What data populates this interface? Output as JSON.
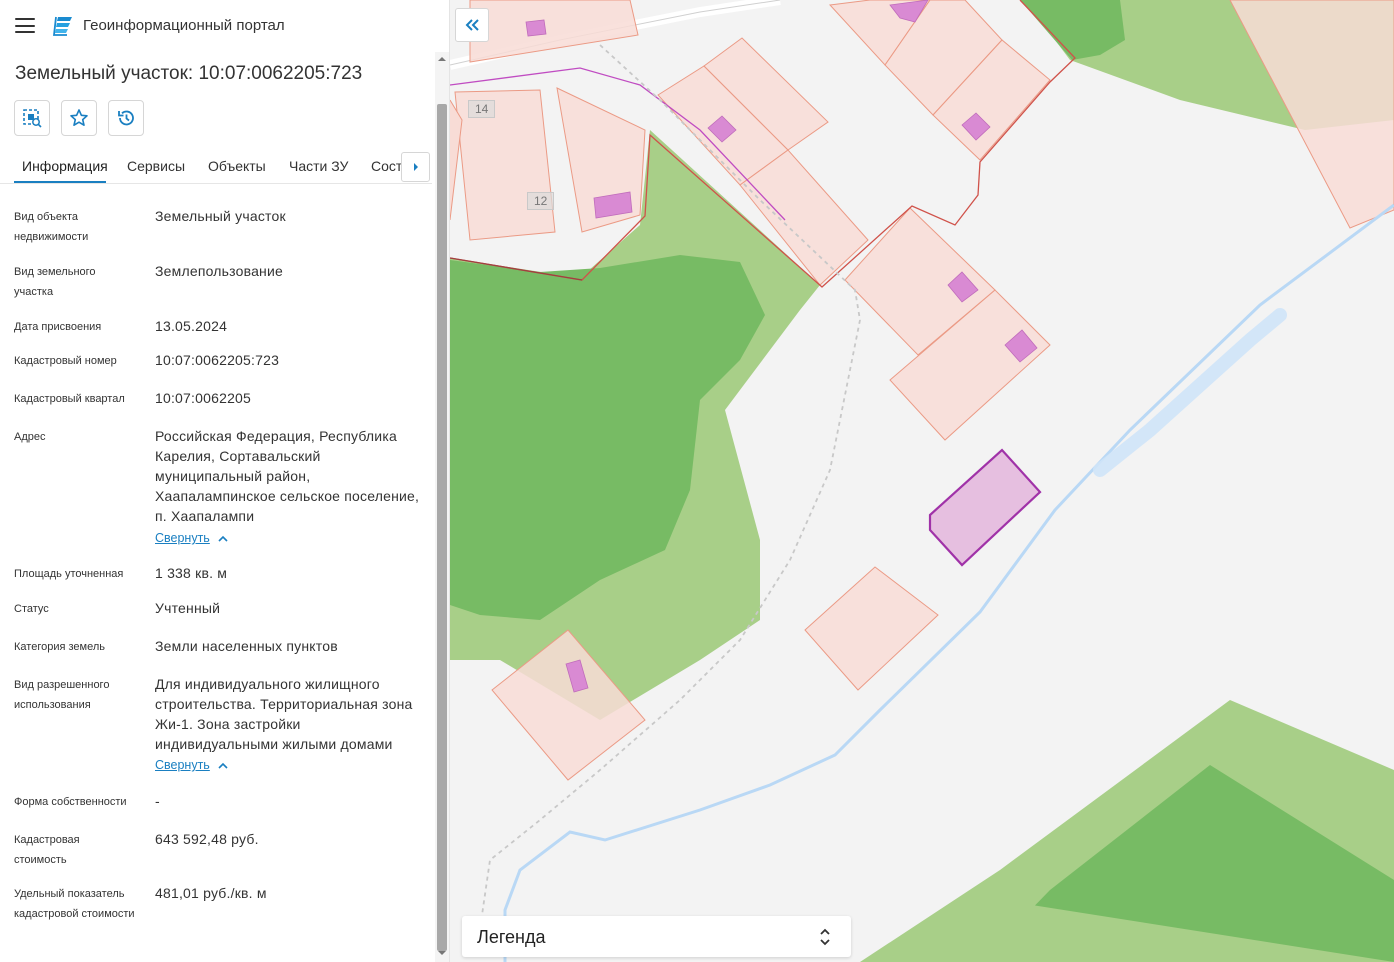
{
  "header": {
    "app_title": "Геоинформационный портал",
    "menu_icon": "hamburger-menu-icon",
    "logo_icon": "portal-logo-icon"
  },
  "card": {
    "title": "Земельный участок: 10:07:0062205:723",
    "tools": [
      {
        "name": "locate-on-map-button",
        "icon": "locate-object-icon"
      },
      {
        "name": "favorite-button",
        "icon": "star-icon"
      },
      {
        "name": "history-button",
        "icon": "history-icon"
      }
    ],
    "tabs": [
      "Информация",
      "Сервисы",
      "Объекты",
      "Части ЗУ",
      "Состав"
    ],
    "active_tab": "Информация"
  },
  "info": {
    "object_type": {
      "label": "Вид объекта недвижимости",
      "value": "Земельный участок"
    },
    "land_type": {
      "label": "Вид земельного участка",
      "value": "Землепользование"
    },
    "assign_date": {
      "label": "Дата присвоения",
      "value": "13.05.2024"
    },
    "cad_number": {
      "label": "Кадастровый номер",
      "value": "10:07:0062205:723"
    },
    "cad_quarter": {
      "label": "Кадастровый квартал",
      "value": "10:07:0062205"
    },
    "address": {
      "label": "Адрес",
      "value": "Российская Федерация, Республика Карелия, Сортавальский муниципальный район, Хаапалампинское сельское поселение, п. Хаапалампи",
      "collapse": "Свернуть"
    },
    "area": {
      "label": "Площадь уточненная",
      "value": "1 338 кв. м"
    },
    "status": {
      "label": "Статус",
      "value": "Учтенный"
    },
    "category": {
      "label": "Категория земель",
      "value": "Земли населенных пунктов"
    },
    "permitted_use": {
      "label": "Вид разрешенного использования",
      "value": "Для индивидуального жилищного строительства. Территориальная зона Жи-1. Зона застройки индивидуальными жилыми домами",
      "collapse": "Свернуть"
    },
    "ownership": {
      "label": "Форма собственности",
      "value": "-"
    },
    "cad_value": {
      "label": "Кадастровая стоимость",
      "value": "643 592,48 руб."
    },
    "specific_value": {
      "label": "Удельный показатель кадастровой стоимости",
      "value": "481,01 руб./кв. м"
    }
  },
  "map": {
    "collapse_icon": "double-chevron-left-icon",
    "parcel_numbers": [
      "14",
      "12"
    ],
    "legend": {
      "label": "Легенда",
      "toggle_icon": "expand-updown-icon"
    },
    "colors": {
      "parcel_fill": "#f8dcd6",
      "parcel_stroke": "#eb9a85",
      "building_fill": "#d98ad3",
      "selected_fill": "#e6bfe0",
      "selected_stroke": "#a032a8",
      "forest_light": "#a8cf88",
      "forest_dark": "#77bb64",
      "water": "#b9d8f5",
      "accent": "#1a7fc1"
    }
  }
}
